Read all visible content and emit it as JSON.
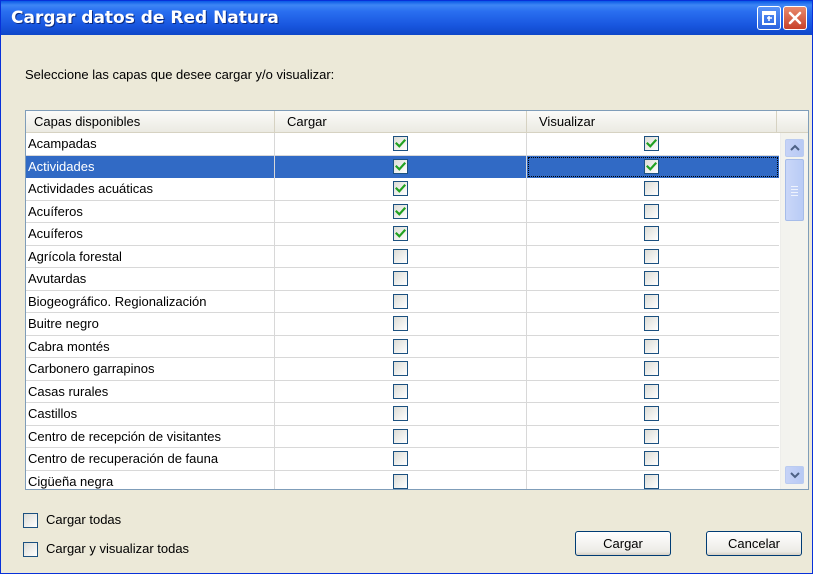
{
  "window": {
    "title": "Cargar datos de Red Natura",
    "restore_icon": "restore-icon",
    "close_icon": "close-icon"
  },
  "instruction": "Seleccione las capas que desee cargar y/o visualizar:",
  "table": {
    "columns": [
      "Capas disponibles",
      "Cargar",
      "Visualizar"
    ],
    "selected_index": 1,
    "rows": [
      {
        "name": "Acampadas",
        "cargar": true,
        "visualizar": true
      },
      {
        "name": "Actividades",
        "cargar": true,
        "visualizar": true
      },
      {
        "name": "Actividades acuáticas",
        "cargar": true,
        "visualizar": false
      },
      {
        "name": "Acuíferos",
        "cargar": true,
        "visualizar": false
      },
      {
        "name": "Acuíferos",
        "cargar": true,
        "visualizar": false
      },
      {
        "name": "Agrícola forestal",
        "cargar": false,
        "visualizar": false
      },
      {
        "name": "Avutardas",
        "cargar": false,
        "visualizar": false
      },
      {
        "name": "Biogeográfico. Regionalización",
        "cargar": false,
        "visualizar": false
      },
      {
        "name": "Buitre negro",
        "cargar": false,
        "visualizar": false
      },
      {
        "name": "Cabra montés",
        "cargar": false,
        "visualizar": false
      },
      {
        "name": "Carbonero garrapinos",
        "cargar": false,
        "visualizar": false
      },
      {
        "name": "Casas rurales",
        "cargar": false,
        "visualizar": false
      },
      {
        "name": "Castillos",
        "cargar": false,
        "visualizar": false
      },
      {
        "name": "Centro de recepción de visitantes",
        "cargar": false,
        "visualizar": false
      },
      {
        "name": "Centro de recuperación de fauna",
        "cargar": false,
        "visualizar": false
      },
      {
        "name": "Cigüeña negra",
        "cargar": false,
        "visualizar": false
      }
    ]
  },
  "options": {
    "load_all": "Cargar todas",
    "load_view_all": "Cargar y visualizar todas",
    "load_all_checked": false,
    "load_view_all_checked": false
  },
  "buttons": {
    "load": "Cargar",
    "cancel": "Cancelar"
  },
  "colors": {
    "selection": "#316ac5",
    "check": "#21a121",
    "titlebar": "#1957e0"
  }
}
